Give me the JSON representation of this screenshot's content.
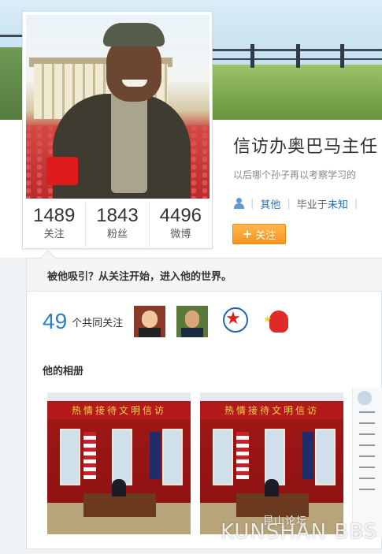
{
  "profile": {
    "name": "信访办奥巴马主任",
    "bio": "以后哪个孙子再以考察学习的",
    "category": "其他",
    "education_prefix": "毕业于",
    "education_value": "未知",
    "follow_label": "关注"
  },
  "stats": [
    {
      "value": "1489",
      "label": "关注"
    },
    {
      "value": "1843",
      "label": "粉丝"
    },
    {
      "value": "4496",
      "label": "微博"
    }
  ],
  "common": {
    "prompt": "被他吸引？从关注开始，进入他的世界。",
    "count": "49",
    "label": "个共同关注"
  },
  "album": {
    "title": "他的相册",
    "banner_text": "热情接待文明信访"
  },
  "watermark": {
    "main": "KUNSHAN BBS",
    "sub": "昆山论坛"
  },
  "colors": {
    "accent": "#f7931e",
    "link": "#2a6fb5",
    "count": "#2a82c6"
  }
}
